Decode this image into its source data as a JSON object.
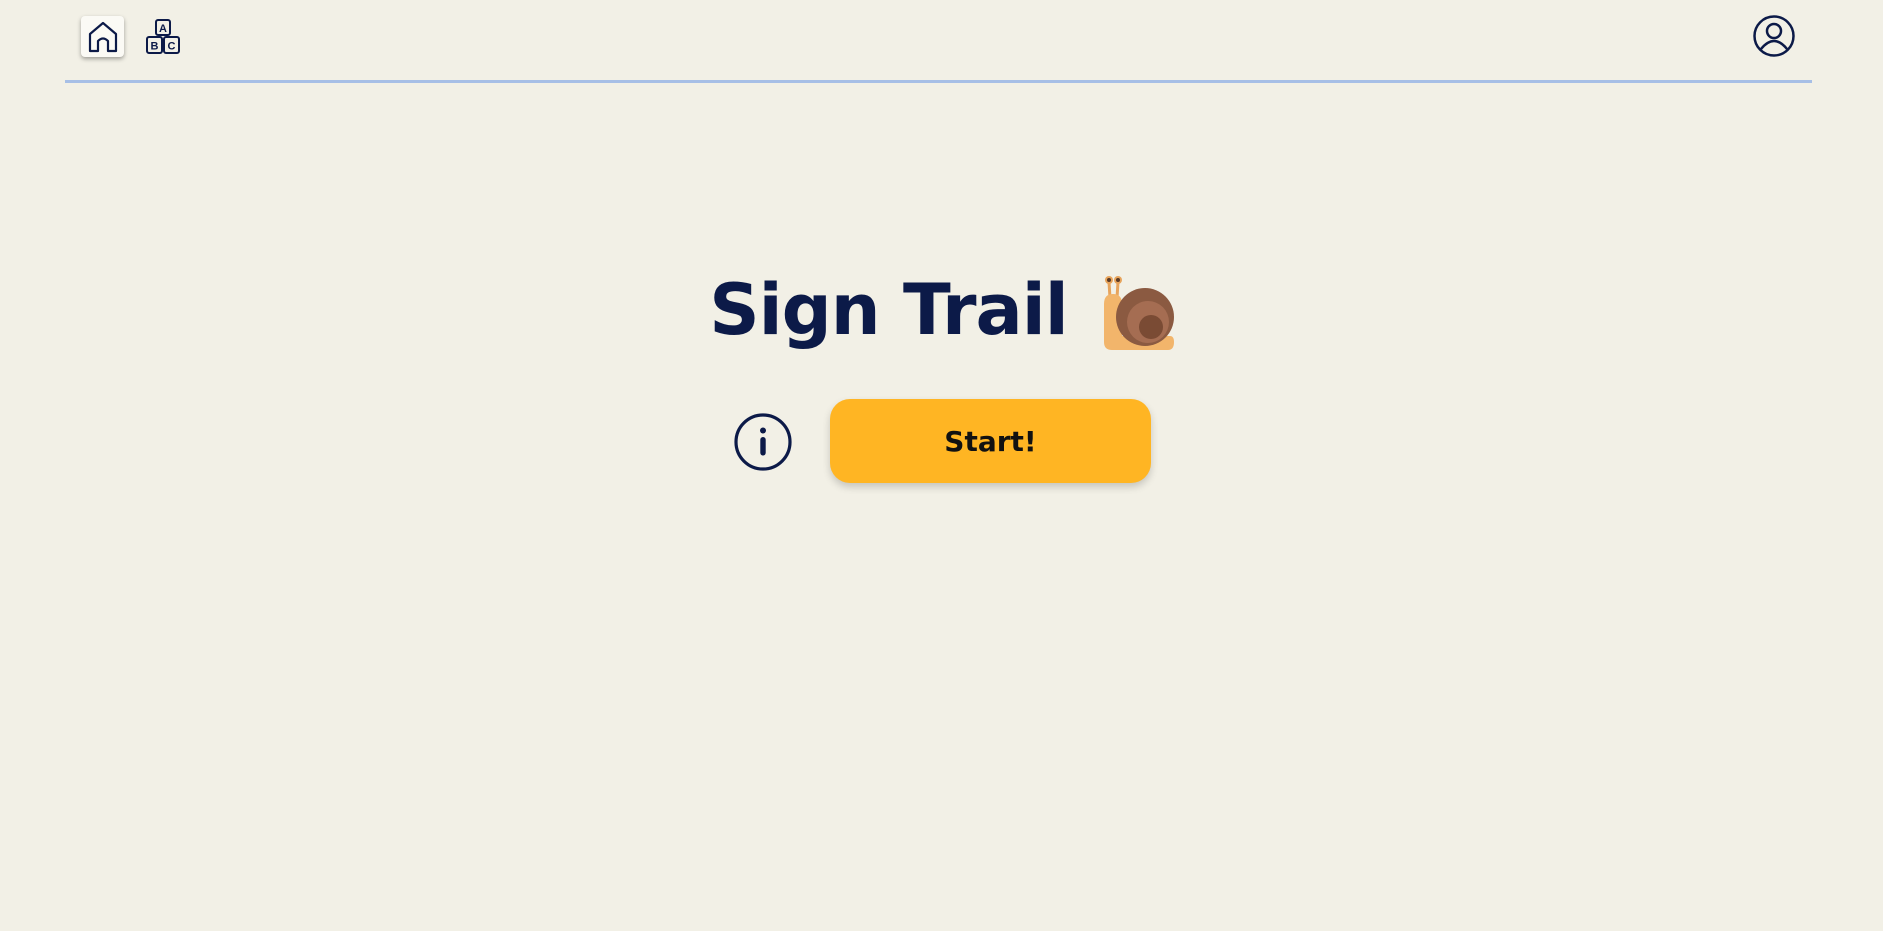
{
  "header": {
    "nav": [
      {
        "name": "home",
        "icon": "home-icon"
      },
      {
        "name": "alphabet",
        "icon": "abc-blocks-icon",
        "block_letters": [
          "A",
          "B",
          "C"
        ]
      }
    ],
    "profile_icon": "user-circle-icon"
  },
  "main": {
    "title": "Sign Trail",
    "title_emoji": "snail-icon",
    "info_icon": "info-icon",
    "start_label": "Start!"
  },
  "colors": {
    "background": "#f2f0e6",
    "title": "#0c1a48",
    "start_button": "#ffb523",
    "divider": "#a7bfe6"
  }
}
